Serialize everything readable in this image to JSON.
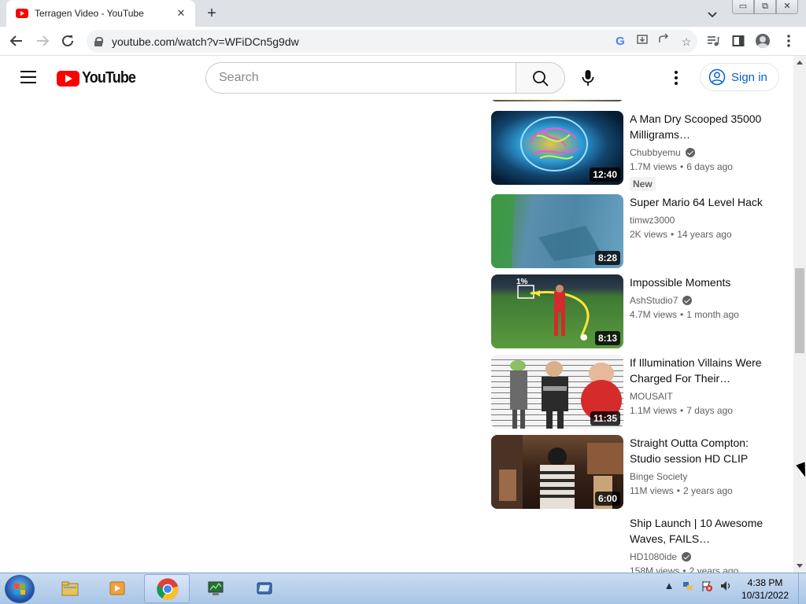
{
  "browser": {
    "tab_title": "Terragen Video - YouTube",
    "tab_close": "✕",
    "new_tab": "+",
    "url": "youtube.com/watch?v=WFiDCn5g9dw",
    "win_minimize": "▭",
    "win_restore": "⧉",
    "win_close": "✕"
  },
  "youtube": {
    "logo_text": "YouTube",
    "search_placeholder": "Search",
    "signin_label": "Sign in"
  },
  "recommendations": [
    {
      "title": "A Man Dry Scooped 35000 Milligrams…",
      "channel": "Chubbyemu",
      "verified": true,
      "views": "1.7M views",
      "age": "6 days ago",
      "badge": "New",
      "duration": "12:40",
      "thumb_colors": [
        "#0b2b4a",
        "#2e9bd6",
        "#e8c24a"
      ]
    },
    {
      "title": "Super Mario 64 Level Hack",
      "channel": "timwz3000",
      "verified": false,
      "views": "2K views",
      "age": "14 years ago",
      "badge": "",
      "duration": "8:28",
      "thumb_colors": [
        "#3d6f8a",
        "#6aa3c0",
        "#3a8f3a"
      ]
    },
    {
      "title": "Impossible Moments",
      "channel": "AshStudio7",
      "verified": true,
      "views": "4.7M views",
      "age": "1 month ago",
      "badge": "",
      "duration": "8:13",
      "thumb_colors": [
        "#2f5d2a",
        "#5b9a3e",
        "#d22b2b"
      ]
    },
    {
      "title": "If Illumination Villains Were Charged For Their…",
      "channel": "MOUSAIT",
      "verified": false,
      "views": "1.1M views",
      "age": "7 days ago",
      "badge": "",
      "duration": "11:35",
      "thumb_colors": [
        "#e9e9e9",
        "#6a6a6a",
        "#d62b2b"
      ]
    },
    {
      "title": "Straight Outta Compton: Studio session HD CLIP",
      "channel": "Binge Society",
      "verified": false,
      "views": "11M views",
      "age": "2 years ago",
      "badge": "",
      "duration": "6:00",
      "thumb_colors": [
        "#3a2418",
        "#8a5a3a",
        "#c9a47a"
      ]
    },
    {
      "title": "Ship Launch | 10 Awesome Waves, FAILS…",
      "channel": "HD1080ide",
      "verified": true,
      "views": "158M views",
      "age": "2 years ago",
      "badge": "",
      "duration": "",
      "thumb_colors": [
        "#ffffff",
        "#ffffff",
        "#ffffff"
      ]
    }
  ],
  "taskbar": {
    "time": "4:38 PM",
    "date": "10/31/2022"
  }
}
